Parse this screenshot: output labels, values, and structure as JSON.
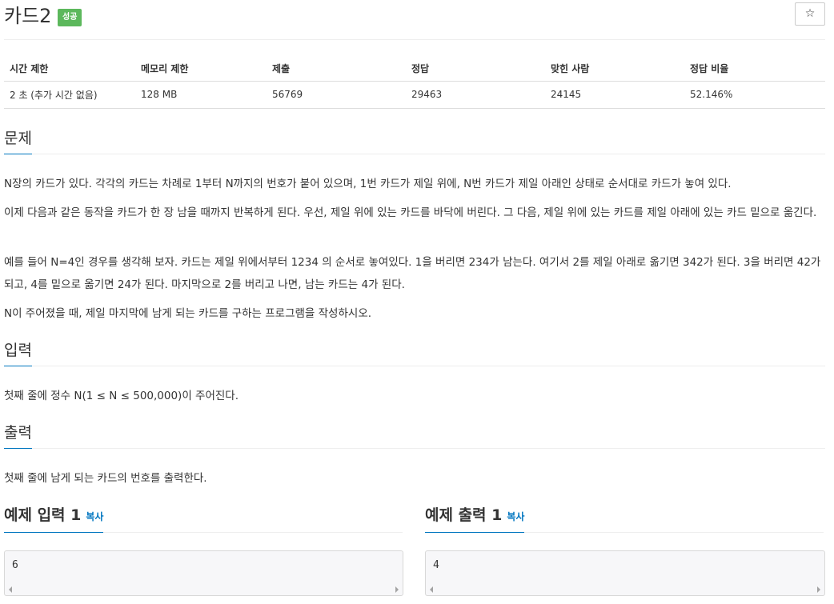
{
  "header": {
    "title": "카드2",
    "badge": "성공",
    "star_icon": "☆"
  },
  "info_table": {
    "headers": [
      "시간 제한",
      "메모리 제한",
      "제출",
      "정답",
      "맞힌 사람",
      "정답 비율"
    ],
    "values": [
      "2 초 (추가 시간 없음)",
      "128 MB",
      "56769",
      "29463",
      "24145",
      "52.146%"
    ]
  },
  "sections": {
    "problem": {
      "title": "문제",
      "paragraphs": [
        "N장의 카드가 있다. 각각의 카드는 차례로 1부터 N까지의 번호가 붙어 있으며, 1번 카드가 제일 위에, N번 카드가 제일 아래인 상태로 순서대로 카드가 놓여 있다.",
        "이제 다음과 같은 동작을 카드가 한 장 남을 때까지 반복하게 된다. 우선, 제일 위에 있는 카드를 바닥에 버린다. 그 다음, 제일 위에 있는 카드를 제일 아래에 있는 카드 밑으로 옮긴다.",
        "예를 들어 N=4인 경우를 생각해 보자. 카드는 제일 위에서부터 1234 의 순서로 놓여있다. 1을 버리면 234가 남는다. 여기서 2를 제일 아래로 옮기면 342가 된다. 3을 버리면 42가 되고, 4를 밑으로 옮기면 24가 된다. 마지막으로 2를 버리고 나면, 남는 카드는 4가 된다.",
        "N이 주어졌을 때, 제일 마지막에 남게 되는 카드를 구하는 프로그램을 작성하시오."
      ]
    },
    "input": {
      "title": "입력",
      "text": "첫째 줄에 정수 N(1 ≤ N ≤ 500,000)이 주어진다."
    },
    "output": {
      "title": "출력",
      "text": "첫째 줄에 남게 되는 카드의 번호를 출력한다."
    }
  },
  "samples": {
    "input": {
      "title": "예제 입력 1",
      "copy": "복사",
      "value": "6"
    },
    "output": {
      "title": "예제 출력 1",
      "copy": "복사",
      "value": "4"
    }
  }
}
